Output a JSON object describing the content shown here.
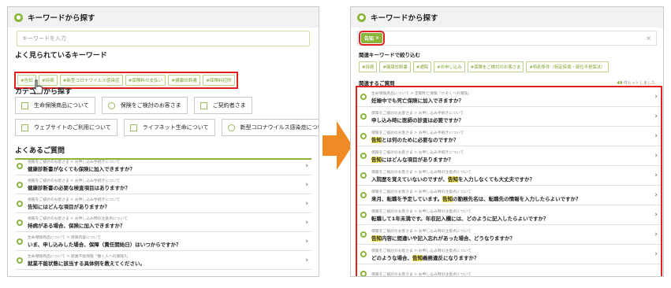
{
  "left": {
    "header": "キーワードから探す",
    "search_placeholder": "キーワードを入力",
    "popular_title": "よく見られているキーワード",
    "keywords": [
      "#告知",
      "#持病",
      "#新型コロナウイルス感染症",
      "#保険料の支払い",
      "#健康診断書",
      "#保険料控除"
    ],
    "category_title": "カテゴリから探す",
    "categories_row1": [
      "生命保険商品について",
      "保険をご検討のお客さま",
      "ご契約者さま"
    ],
    "categories_row2": [
      "ウェブサイトのご利用について",
      "ライフネット生命について",
      "新型コロナウイルス感染症について"
    ],
    "faq_title": "よくあるご質問",
    "faqs": [
      {
        "crumb": "保険をご検討のお客さま > お申し込み手続きについて",
        "q": "健康診断書がなくても保険に加入できますか？"
      },
      {
        "crumb": "保険をご検討のお客さま > お申し込み手続きについて",
        "q": "健康診断書の必要な検査項目はありますか？"
      },
      {
        "crumb": "保険をご検討のお客さま > お申し込み手続きについて",
        "q": "告知にはどんな項目がありますか？"
      },
      {
        "crumb": "保険をご検討のお客さま > お申し込み時の注意点について",
        "q": "持病がある場合、保険に加入できますか？"
      },
      {
        "crumb": "生命保険商品について > 保障内容について",
        "q": "いま、申し込みした場合、保障（責任開始日）はいつからですか？"
      },
      {
        "crumb": "生命保険商品について > 就業不能保険「働く人への保険3」",
        "q": "就業不能状態に該当する具体例を教えてください。"
      }
    ]
  },
  "right": {
    "header": "キーワードから探す",
    "chip": "告知",
    "chip_close": "×",
    "clear": "×",
    "narrow_title": "関連キーワードで絞り込む",
    "keywords": [
      "#持病",
      "#健康診断書",
      "#通院",
      "#お申し込み",
      "#保険をご検討のお客さま",
      "#特別条件（特定疾病・部位不担保法）"
    ],
    "related_title": "関連するご質問",
    "count_num": "49",
    "count_suffix": "件ヒットしました",
    "faqs": [
      {
        "crumb": "生命保険商品について > 定期死亡保険「かぞくへの保険」",
        "pre": "妊娠中でも死亡保険に加入できますか？",
        "hl": "",
        "post": ""
      },
      {
        "crumb": "保険をご検討のお客さま > お申し込み手続きについて",
        "pre": "申し込み時に医師の診査は必要ですか？",
        "hl": "",
        "post": ""
      },
      {
        "crumb": "保険をご検討のお客さま > お申し込み手続きについて",
        "pre": "",
        "hl": "告知",
        "post": "とは何のために必要なのですか？"
      },
      {
        "crumb": "保険をご検討のお客さま > お申し込み手続きについて",
        "pre": "",
        "hl": "告知",
        "post": "にはどんな項目がありますか？"
      },
      {
        "crumb": "保険をご検討のお客さま > お申し込み時の注意点について",
        "pre": "入院歴を覚えていないのですが、",
        "hl": "告知",
        "post": "を入力しなくても大丈夫ですか？"
      },
      {
        "crumb": "保険をご検討のお客さま > お申し込み時の注意点について",
        "pre": "来月、転職を予定しています。",
        "hl": "告知",
        "post": "の勤務先名は、転職先の情報を入力したらよいですか？"
      },
      {
        "crumb": "保険をご検討のお客さま > お申し込み時の注意点について",
        "pre": "転職して1年未満です。年収記入欄には、どのように記入したらよいですか？",
        "hl": "",
        "post": ""
      },
      {
        "crumb": "保険をご検討のお客さま > お申し込み時の注意点について",
        "pre": "",
        "hl": "告知",
        "post": "内容に間違いや記入忘れがあった場合、どうなりますか？"
      },
      {
        "crumb": "保険をご検討のお客さま > お申し込み時の注意点について",
        "pre": "どのような場合、",
        "hl": "告知",
        "post": "義務違反になりますか？"
      },
      {
        "crumb": "保険をご検討のお客さま > お申し込み時の注意点について",
        "pre": "",
        "hl": "",
        "post": ""
      }
    ]
  }
}
